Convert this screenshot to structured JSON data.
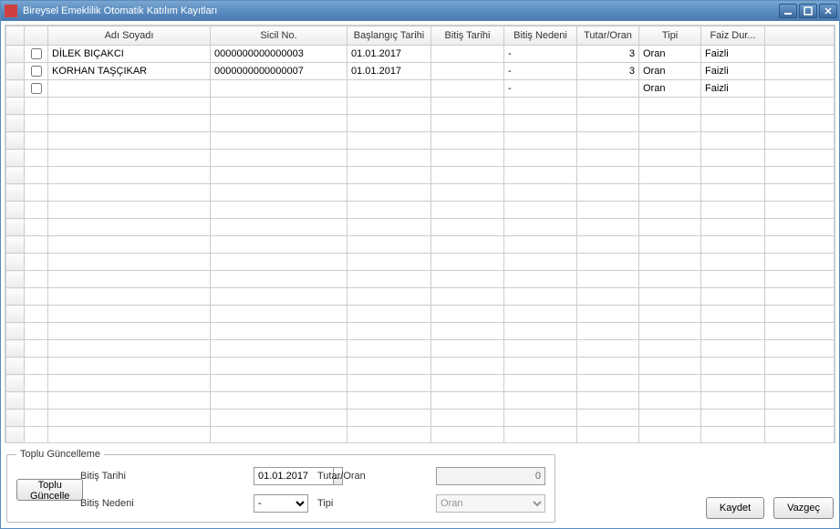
{
  "window": {
    "title": "Bireysel Emeklilik Otomatik Katılım Kayıtları"
  },
  "grid": {
    "columns": {
      "rowhdr": "",
      "chk": "",
      "name": "Adı Soyadı",
      "sicil": "Sicil No.",
      "baslangic": "Başlangıç Tarihi",
      "bitis": "Bitiş Tarihi",
      "neden": "Bitiş Nedeni",
      "tutar": "Tutar/Oran",
      "tipi": "Tipi",
      "faiz": "Faiz Dur..."
    },
    "rows": [
      {
        "checked": false,
        "name": "DİLEK BIÇAKCI",
        "sicil": "0000000000000003",
        "baslangic": "01.01.2017",
        "bitis": "",
        "neden": "-",
        "tutar": "3",
        "tipi": "Oran",
        "faiz": "Faizli"
      },
      {
        "checked": false,
        "name": "KORHAN TAŞÇIKAR",
        "sicil": "0000000000000007",
        "baslangic": "01.01.2017",
        "bitis": "",
        "neden": "-",
        "tutar": "3",
        "tipi": "Oran",
        "faiz": "Faizli"
      },
      {
        "checked": false,
        "name": "",
        "sicil": "",
        "baslangic": "",
        "bitis": "",
        "neden": "-",
        "tutar": "",
        "tipi": "Oran",
        "faiz": "Faizli"
      }
    ]
  },
  "bulk": {
    "legend": "Toplu Güncelleme",
    "labels": {
      "bitis": "Bitiş Tarihi",
      "neden": "Bitiş Nedeni",
      "tutar": "Tutar/Oran",
      "tipi": "Tipi"
    },
    "values": {
      "bitis": "01.01.2017",
      "neden": "-",
      "tutar": "0",
      "tipi": "Oran"
    },
    "buttons": {
      "update": "Toplu Güncelle"
    }
  },
  "buttons": {
    "save": "Kaydet",
    "cancel": "Vazgeç"
  }
}
